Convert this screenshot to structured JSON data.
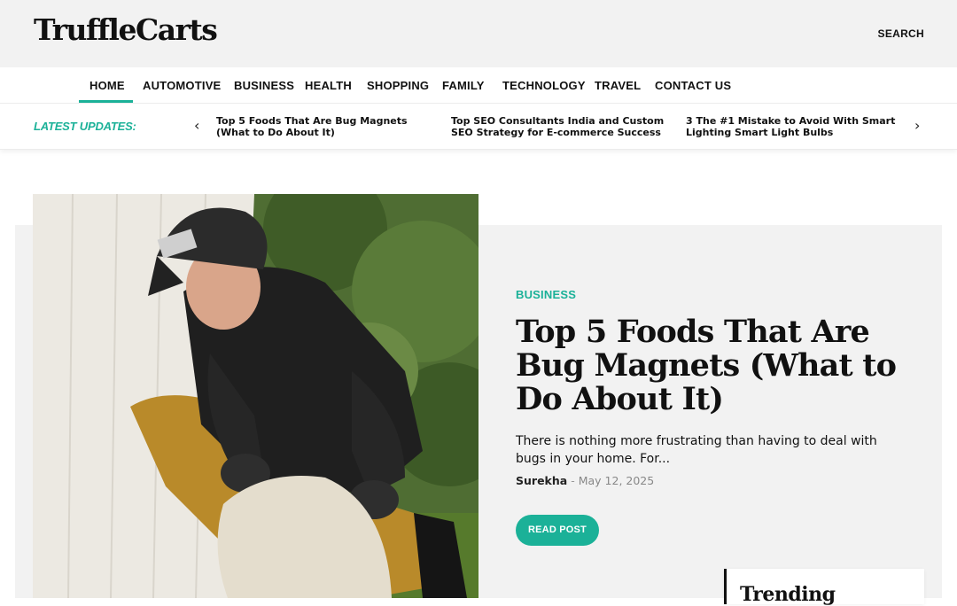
{
  "site": {
    "logo": "TruffleCarts",
    "search_label": "SEARCH"
  },
  "nav": {
    "items": [
      {
        "label": "HOME",
        "active": true
      },
      {
        "label": "AUTOMOTIVE"
      },
      {
        "label": "BUSINESS"
      },
      {
        "label": "HEALTH"
      },
      {
        "label": "SHOPPING"
      },
      {
        "label": "FAMILY"
      },
      {
        "label": "TECHNOLOGY"
      },
      {
        "label": "TRAVEL"
      },
      {
        "label": "CONTACT US"
      }
    ]
  },
  "ticker": {
    "label": "LATEST UPDATES:",
    "prev_icon": "chevron-left-icon",
    "next_icon": "chevron-right-icon",
    "items": [
      "Top 5 Foods That Are Bug Magnets (What to Do About It)",
      "Top SEO Consultants India and Custom SEO Strategy for E-commerce Success",
      "3 The #1 Mistake to Avoid With Smart Lighting Smart Light Bulbs"
    ]
  },
  "featured": {
    "category": "BUSINESS",
    "title": "Top 5 Foods That Are Bug Magnets (What to Do About It)",
    "excerpt": "There is nothing  more frustrating than having to deal with bugs in your home. For...",
    "author": "Surekha",
    "separator": "-",
    "date": "May 12, 2025",
    "button": "READ POST"
  },
  "sidebar": {
    "trending_title": "Trending"
  },
  "colors": {
    "accent": "#1bb198",
    "text": "#111111",
    "panel": "#f2f2f2"
  }
}
